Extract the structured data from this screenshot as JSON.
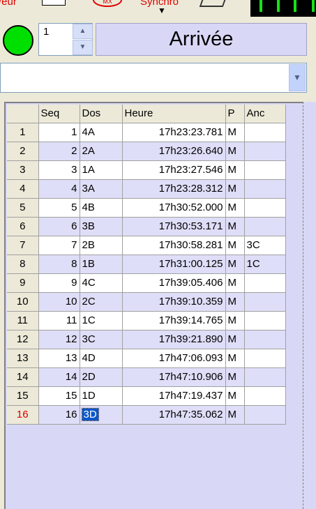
{
  "toolbar": {
    "left_label": "/eur",
    "sync_label": "Synchro",
    "mx_label": "MX"
  },
  "status": {
    "indicator_color": "#00e000",
    "spinner_value": "1",
    "title": "Arrivée"
  },
  "combo": {
    "value": ""
  },
  "grid": {
    "columns": [
      "Seq",
      "Dos",
      "Heure",
      "P",
      "Anc"
    ],
    "rows": [
      {
        "n": "1",
        "seq": "1",
        "dos": "4A",
        "heure": "17h23:23.781",
        "p": "M",
        "anc": ""
      },
      {
        "n": "2",
        "seq": "2",
        "dos": "2A",
        "heure": "17h23:26.640",
        "p": "M",
        "anc": ""
      },
      {
        "n": "3",
        "seq": "3",
        "dos": "1A",
        "heure": "17h23:27.546",
        "p": "M",
        "anc": ""
      },
      {
        "n": "4",
        "seq": "4",
        "dos": "3A",
        "heure": "17h23:28.312",
        "p": "M",
        "anc": ""
      },
      {
        "n": "5",
        "seq": "5",
        "dos": "4B",
        "heure": "17h30:52.000",
        "p": "M",
        "anc": ""
      },
      {
        "n": "6",
        "seq": "6",
        "dos": "3B",
        "heure": "17h30:53.171",
        "p": "M",
        "anc": ""
      },
      {
        "n": "7",
        "seq": "7",
        "dos": "2B",
        "heure": "17h30:58.281",
        "p": "M",
        "anc": "3C"
      },
      {
        "n": "8",
        "seq": "8",
        "dos": "1B",
        "heure": "17h31:00.125",
        "p": "M",
        "anc": "1C"
      },
      {
        "n": "9",
        "seq": "9",
        "dos": "4C",
        "heure": "17h39:05.406",
        "p": "M",
        "anc": ""
      },
      {
        "n": "10",
        "seq": "10",
        "dos": "2C",
        "heure": "17h39:10.359",
        "p": "M",
        "anc": ""
      },
      {
        "n": "11",
        "seq": "11",
        "dos": "1C",
        "heure": "17h39:14.765",
        "p": "M",
        "anc": ""
      },
      {
        "n": "12",
        "seq": "12",
        "dos": "3C",
        "heure": "17h39:21.890",
        "p": "M",
        "anc": ""
      },
      {
        "n": "13",
        "seq": "13",
        "dos": "4D",
        "heure": "17h47:06.093",
        "p": "M",
        "anc": ""
      },
      {
        "n": "14",
        "seq": "14",
        "dos": "2D",
        "heure": "17h47:10.906",
        "p": "M",
        "anc": ""
      },
      {
        "n": "15",
        "seq": "15",
        "dos": "1D",
        "heure": "17h47:19.437",
        "p": "M",
        "anc": ""
      },
      {
        "n": "16",
        "seq": "16",
        "dos": "3D",
        "heure": "17h47:35.062",
        "p": "M",
        "anc": ""
      }
    ],
    "current_row": 16
  }
}
